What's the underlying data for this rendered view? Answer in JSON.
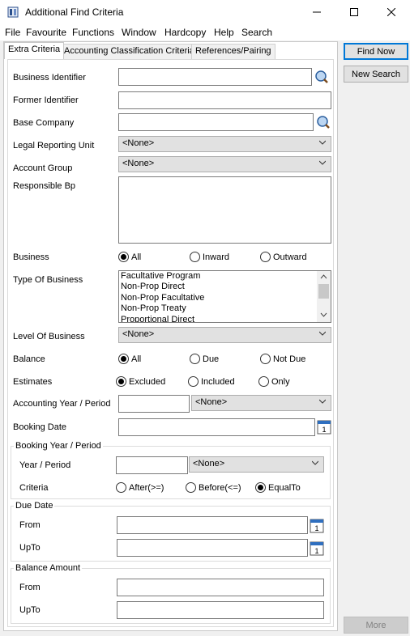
{
  "window": {
    "title": "Additional Find Criteria"
  },
  "menu": [
    "File",
    "Favourite",
    "Functions",
    "Window",
    "Hardcopy",
    "Help",
    "Search"
  ],
  "tabs": [
    "Extra Criteria",
    "Accounting Classification Criteria",
    "References/Pairing"
  ],
  "buttons": {
    "find_now": "Find Now",
    "new_search": "New Search",
    "more": "More"
  },
  "form": {
    "business_identifier": "Business Identifier",
    "former_identifier": "Former Identifier",
    "base_company": "Base Company",
    "legal_reporting_unit": {
      "label": "Legal Reporting Unit",
      "value": "<None>"
    },
    "account_group": {
      "label": "Account Group",
      "value": "<None>"
    },
    "responsible_bp": "Responsible Bp",
    "business": {
      "label": "Business",
      "options": [
        "All",
        "Inward",
        "Outward"
      ],
      "selected": "All"
    },
    "type_of_business": {
      "label": "Type Of Business",
      "items": [
        "Facultative Program",
        "Non-Prop Direct",
        "Non-Prop Facultative",
        "Non-Prop Treaty",
        "Proportional Direct"
      ]
    },
    "level_of_business": {
      "label": "Level Of Business",
      "value": "<None>"
    },
    "balance": {
      "label": "Balance",
      "options": [
        "All",
        "Due",
        "Not Due"
      ],
      "selected": "All"
    },
    "estimates": {
      "label": "Estimates",
      "options": [
        "Excluded",
        "Included",
        "Only"
      ],
      "selected": "Excluded"
    },
    "accounting_year_period": {
      "label": "Accounting Year / Period",
      "value": "<None>"
    },
    "booking_date": "Booking Date",
    "booking_year_period": {
      "title": "Booking Year / Period",
      "year_period_label": "Year / Period",
      "value": "<None>",
      "criteria_label": "Criteria",
      "criteria_options": [
        "After(>=)",
        "Before(<=)",
        "EqualTo"
      ],
      "criteria_selected": "EqualTo"
    },
    "due_date": {
      "title": "Due Date",
      "from": "From",
      "upto": "UpTo"
    },
    "balance_amount": {
      "title": "Balance Amount",
      "from": "From",
      "upto": "UpTo"
    }
  }
}
